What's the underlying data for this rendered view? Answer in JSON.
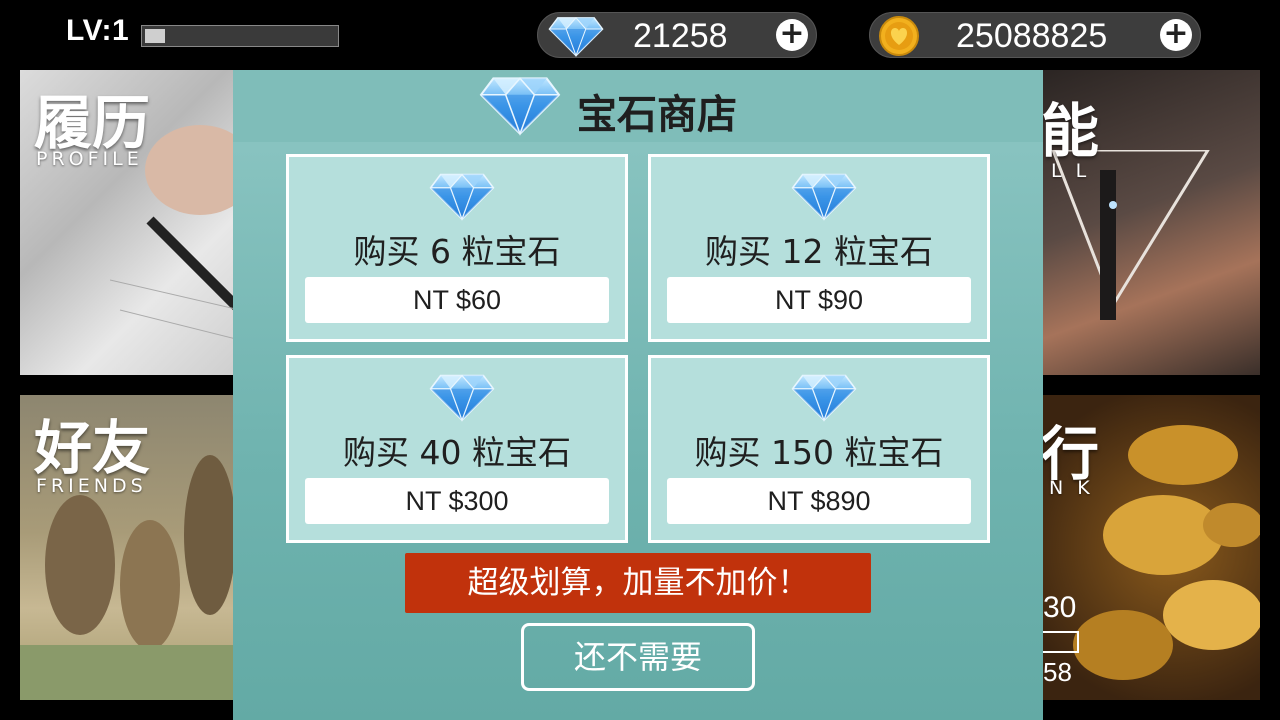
{
  "topbar": {
    "level_text": "LV:1",
    "xp_progress": 0.1,
    "gems_value": "21258",
    "coins_value": "25088825",
    "plus_symbol": "+"
  },
  "tiles": {
    "profile": {
      "title": "履历",
      "subtitle": "PROFILE"
    },
    "friends": {
      "title": "好友",
      "subtitle": "FRIENDS"
    },
    "skill": {
      "title": "能",
      "subtitle": "L L"
    },
    "rank": {
      "title": "行",
      "subtitle": "N K",
      "number_partial": "30",
      "number_partial_2": "58"
    }
  },
  "modal": {
    "title": "宝石商店",
    "packages": [
      {
        "label": "购买 6 粒宝石",
        "price": "NT $60"
      },
      {
        "label": "购买 12 粒宝石",
        "price": "NT $90"
      },
      {
        "label": "购买 40 粒宝石",
        "price": "NT $300"
      },
      {
        "label": "购买 150 粒宝石",
        "price": "NT $890"
      }
    ],
    "promo_text": "超级划算，加量不加价！",
    "dismiss_label": "还不需要"
  },
  "colors": {
    "modal_bg": "#7fbdb9",
    "card_bg": "#b5dfdc",
    "promo_bg": "#c1320c",
    "gem_blue": "#2f8fe8",
    "coin_gold": "#f2b01e"
  },
  "icons": {
    "gem": "diamond-icon",
    "coin": "heart-coin-icon",
    "plus": "plus-circle-icon"
  }
}
